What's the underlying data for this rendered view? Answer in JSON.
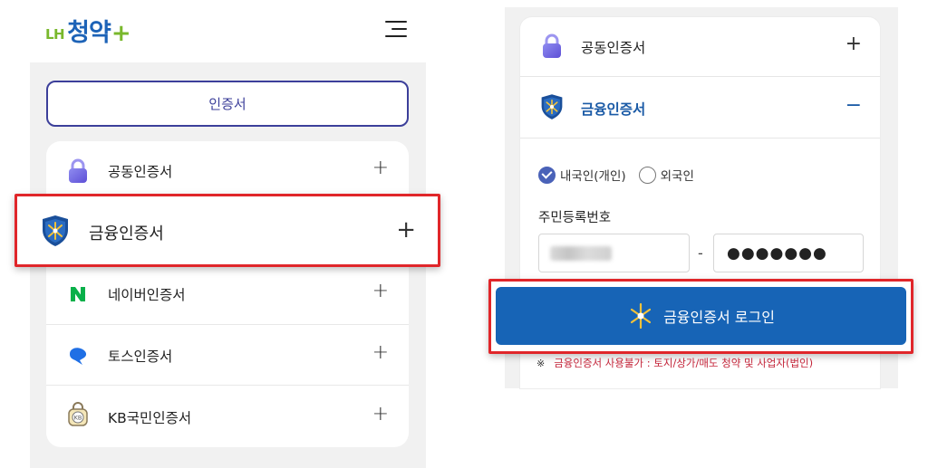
{
  "left": {
    "brand": {
      "prefix": "LH",
      "name": "청약",
      "suffix": "+"
    },
    "tab_label": "인증서",
    "items": [
      {
        "label": "공동인증서",
        "icon": "lock-icon",
        "toggle": "+"
      },
      {
        "label": "금융인증서",
        "icon": "shield-key-icon",
        "toggle": "+"
      },
      {
        "label": "네이버인증서",
        "icon": "naver-icon",
        "toggle": "+"
      },
      {
        "label": "토스인증서",
        "icon": "toss-icon",
        "toggle": "+"
      },
      {
        "label": "KB국민인증서",
        "icon": "kb-icon",
        "toggle": "+"
      }
    ]
  },
  "right": {
    "items": [
      {
        "label": "공동인증서",
        "icon": "lock-icon",
        "toggle": "+"
      },
      {
        "label": "금융인증서",
        "icon": "shield-key-icon",
        "toggle": "−"
      }
    ],
    "radios": [
      {
        "label": "내국인(개인)",
        "checked": true
      },
      {
        "label": "외국인",
        "checked": false
      }
    ],
    "field_label": "주민등록번호",
    "ssn_back_mask": "●●●●●●●",
    "dash": "-",
    "login_label": "금융인증서 로그인",
    "notice_mark": "※",
    "notice": "금융인증서 사용불가 : 토지/상가/매도 청약 및 사업자(법인)"
  },
  "colors": {
    "brand_blue": "#1d63b7",
    "brand_green": "#79b82c",
    "accent_navy": "#3c3f9a",
    "login_blue": "#1764b6",
    "highlight_red": "#e0262a",
    "notice_red": "#c4253a"
  }
}
